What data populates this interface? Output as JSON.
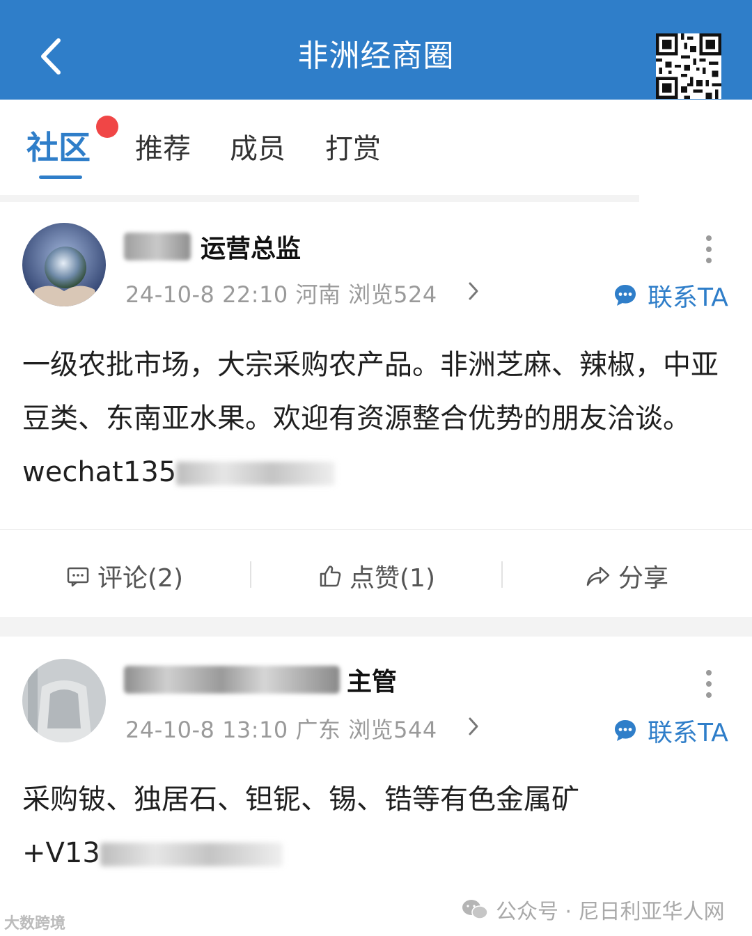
{
  "header": {
    "title": "非洲经商圈",
    "back_icon": "chevron-left-icon"
  },
  "tabs": [
    {
      "label": "社区",
      "active": true,
      "has_badge": true
    },
    {
      "label": "推荐",
      "active": false
    },
    {
      "label": "成员",
      "active": false
    },
    {
      "label": "打赏",
      "active": false
    }
  ],
  "posts": [
    {
      "author_role": "运营总监",
      "meta": "24-10-8 22:10  河南  浏览524",
      "contact_label": "联系TA",
      "content_text": "一级农批市场，大宗采购农产品。非洲芝麻、辣椒，中亚豆类、东南亚水果。欢迎有资源整合优势的朋友洽谈。wechat135",
      "actions": {
        "comment": "评论(2)",
        "like": "点赞(1)",
        "share": "分享"
      }
    },
    {
      "author_role": "主管",
      "meta": "24-10-8 13:10  广东  浏览544",
      "contact_label": "联系TA",
      "content_line1": "采购铍、独居石、钽铌、锡、锆等有色金属矿",
      "content_line2": "+V13"
    }
  ],
  "watermark": {
    "text": "公众号 · 尼日利亚华人网",
    "logo_text": "大数跨境"
  },
  "colors": {
    "primary": "#2f7ec9",
    "badge": "#f04646",
    "meta": "#9a9a9a"
  }
}
